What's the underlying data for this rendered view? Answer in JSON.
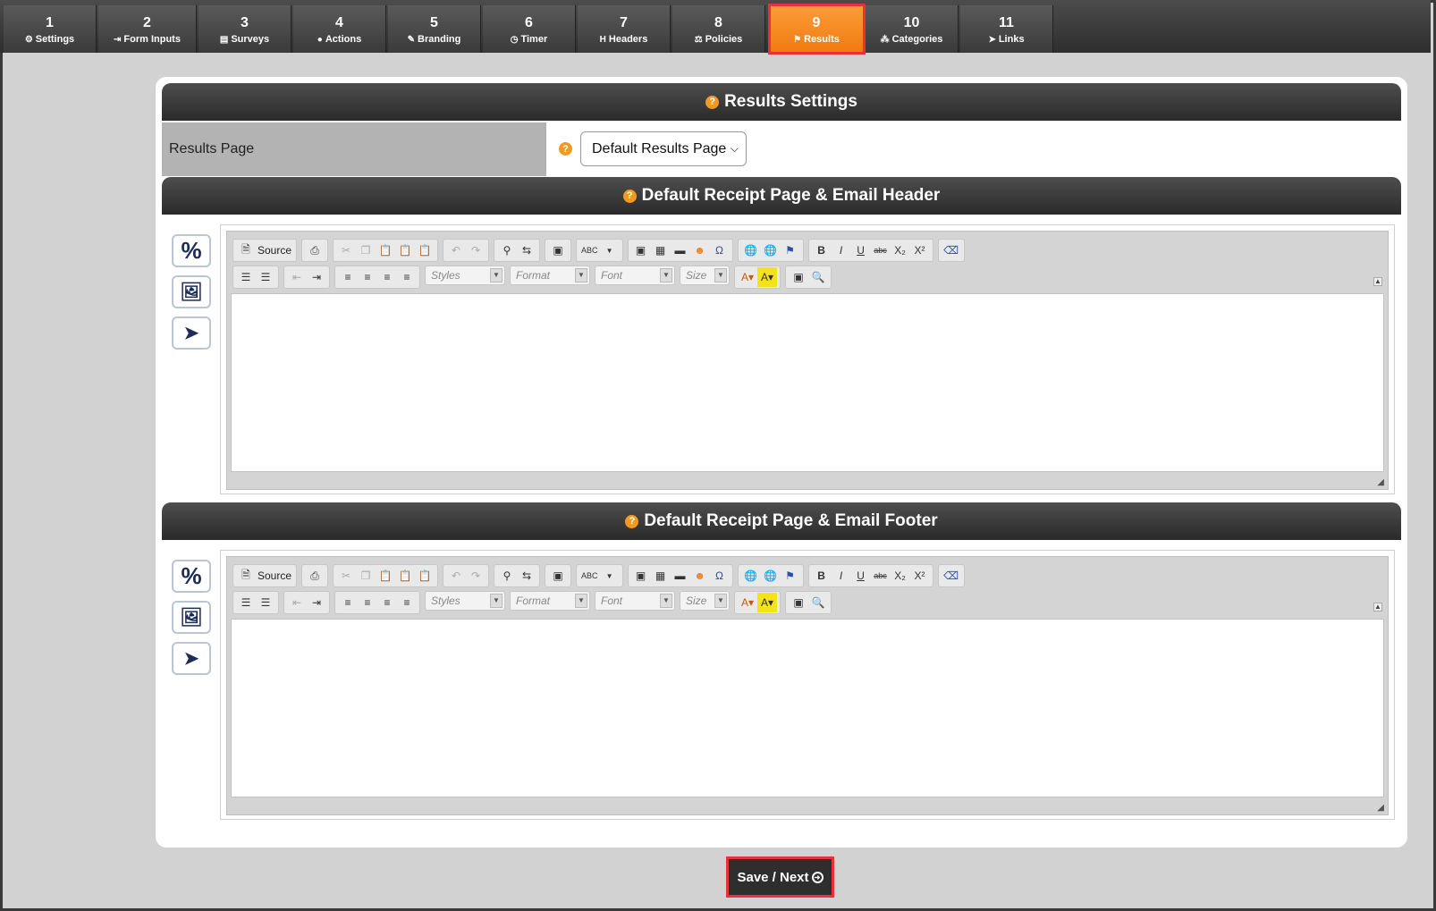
{
  "tabs": [
    {
      "num": "1",
      "label": "Settings",
      "icon": "⚙"
    },
    {
      "num": "2",
      "label": "Form Inputs",
      "icon": "⇥"
    },
    {
      "num": "3",
      "label": "Surveys",
      "icon": "▤"
    },
    {
      "num": "4",
      "label": "Actions",
      "icon": "●"
    },
    {
      "num": "5",
      "label": "Branding",
      "icon": "✎"
    },
    {
      "num": "6",
      "label": "Timer",
      "icon": "◷"
    },
    {
      "num": "7",
      "label": "Headers",
      "icon": "H"
    },
    {
      "num": "8",
      "label": "Policies",
      "icon": "⚖"
    },
    {
      "num": "9",
      "label": "Results",
      "icon": "⚑"
    },
    {
      "num": "10",
      "label": "Categories",
      "icon": "⁂"
    },
    {
      "num": "11",
      "label": "Links",
      "icon": "➤"
    }
  ],
  "active_tab": "9",
  "results_settings": {
    "title": "Results Settings",
    "help": "?",
    "results_page_label": "Results Page",
    "results_page_value": "Default Results Page"
  },
  "header_section": {
    "title": "Default Receipt Page & Email Header",
    "help": "?"
  },
  "footer_section": {
    "title": "Default Receipt Page & Email Footer",
    "help": "?"
  },
  "side_icons": {
    "percent": "%",
    "image": "🖼",
    "pointer": "➤"
  },
  "toolbar": {
    "source_label": "Source",
    "styles_label": "Styles",
    "format_label": "Format",
    "font_label": "Font",
    "size_label": "Size",
    "bold": "B",
    "italic": "I",
    "underline": "U",
    "strike": "abc",
    "subscript": "X₂",
    "superscript": "X²",
    "omega": "Ω",
    "spell": "ABC"
  },
  "save_button": {
    "label": "Save / Next"
  },
  "colors": {
    "accent": "#f58a1f",
    "highlight": "#e8323b",
    "header_bg": "#2e2e2e"
  }
}
